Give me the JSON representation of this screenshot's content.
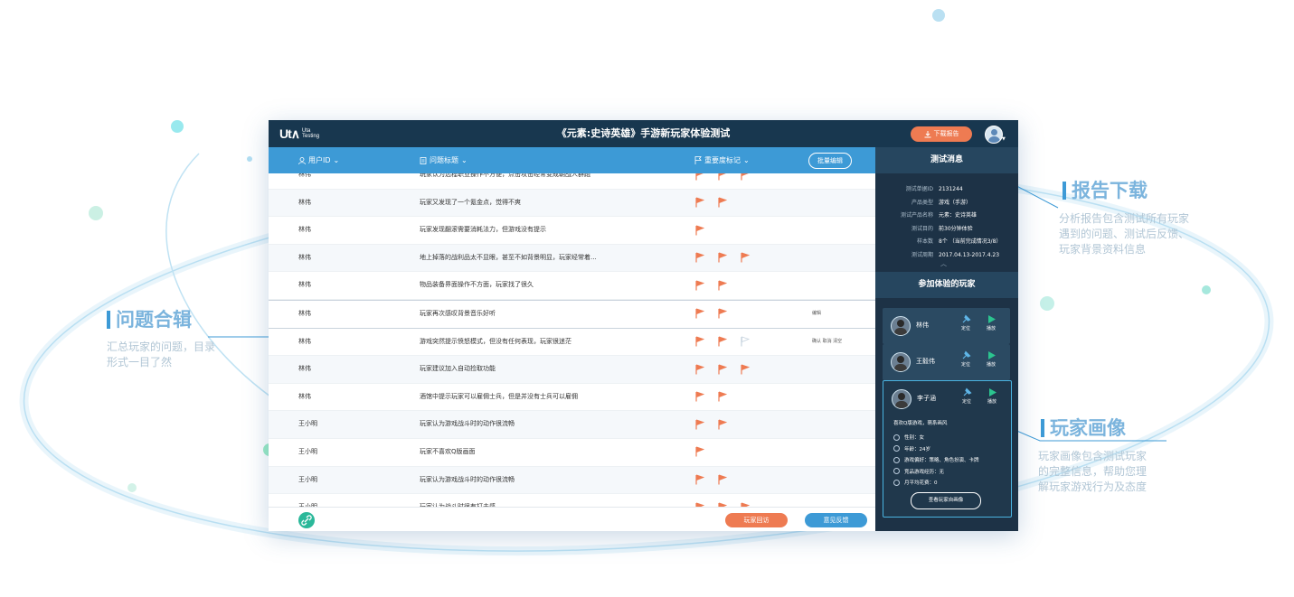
{
  "app": {
    "logo_mark": "Ut∧",
    "logo_sub_1": "Uta",
    "logo_sub_2": "Testing",
    "title": "《元素:史诗英雄》手游新玩家体验测试",
    "download_label": "下载报告"
  },
  "table": {
    "headers": {
      "user_id": "用户ID",
      "issue_title": "问题标题",
      "importance": "重要度标记"
    },
    "batch_edit": "批量编辑",
    "rows": [
      {
        "user": "林伟",
        "title": "玩家认为远程职业操作不方便，点击攻击经常变成朝战人群跑",
        "flags": [
          1,
          1,
          1
        ],
        "tools": ""
      },
      {
        "user": "林伟",
        "title": "玩家又发现了一个氪金点，觉得不爽",
        "flags": [
          1,
          1
        ],
        "tools": ""
      },
      {
        "user": "林伟",
        "title": "玩家发现翻滚需要消耗法力，但游戏没有提示",
        "flags": [
          1
        ],
        "tools": ""
      },
      {
        "user": "林伟",
        "title": "地上掉落的战利品太不显眼，甚至不如背景明显，玩家经常着...",
        "flags": [
          1,
          1,
          1
        ],
        "tools": ""
      },
      {
        "user": "林伟",
        "title": "物品装备界面操作不方面，玩家找了很久",
        "flags": [
          1,
          1
        ],
        "tools": ""
      },
      {
        "user": "林伟",
        "title": "玩家再次感叹背景音乐好听",
        "flags": [
          1,
          1
        ],
        "tools": "编辑",
        "active": true
      },
      {
        "user": "林伟",
        "title": "游戏突然提示愤怒模式，但没有任何表现，玩家很迷茫",
        "flags": [
          1,
          1,
          0
        ],
        "tools": "确认  取消  清空"
      },
      {
        "user": "林伟",
        "title": "玩家建议加入自动捡取功能",
        "flags": [
          1,
          1,
          1
        ],
        "tools": ""
      },
      {
        "user": "林伟",
        "title": "酒馆中提示玩家可以雇佣士兵，但是并没有士兵可以雇佣",
        "flags": [
          1,
          1
        ],
        "tools": ""
      },
      {
        "user": "王小明",
        "title": "玩家认为游戏战斗时的动作很流畅",
        "flags": [
          1,
          1
        ],
        "tools": ""
      },
      {
        "user": "王小明",
        "title": "玩家不喜欢Q版画面",
        "flags": [
          1
        ],
        "tools": ""
      },
      {
        "user": "王小明",
        "title": "玩家认为游戏战斗时的动作很流畅",
        "flags": [
          1,
          1
        ],
        "tools": ""
      },
      {
        "user": "王小明",
        "title": "玩家认为战斗时很有打击感",
        "flags": [
          1,
          1,
          1
        ],
        "tools": ""
      }
    ]
  },
  "bottom": {
    "review_label": "玩家回访",
    "feedback_label": "意见反馈"
  },
  "sidebar": {
    "test_info_title": "测试消息",
    "info": [
      {
        "label": "测试单据ID",
        "value": "2131244"
      },
      {
        "label": "产品类型",
        "value": "游戏（手游）"
      },
      {
        "label": "测试产品名称",
        "value": "元素：史诗英雄"
      },
      {
        "label": "测试目的",
        "value": "前30分钟体验"
      },
      {
        "label": "样本数",
        "value": "8个 （当前完成情况3/8）"
      },
      {
        "label": "测试周期",
        "value": "2017.04.13-2017.4.23"
      }
    ],
    "players_title": "参加体验的玩家",
    "locate_label": "定位",
    "play_label": "播放",
    "players": [
      {
        "name": "林伟"
      },
      {
        "name": "王毅伟"
      },
      {
        "name": "李子涵"
      }
    ],
    "profile": {
      "tagline": "喜欢Q版游戏，萌系画风",
      "details": [
        "性别：女",
        "年龄：24岁",
        "游戏偏好：策略、角色扮演、卡牌",
        "竞品游戏经历：无",
        "月平均花费：0"
      ],
      "button": "查看玩家自画像"
    }
  },
  "annotations": {
    "report": {
      "title": "报告下载",
      "desc": [
        "分析报告包含测试所有玩家",
        "遇到的问题、测试后反馈、",
        "玩家背景资料信息"
      ]
    },
    "issues": {
      "title": "问题合辑",
      "desc": [
        "汇总玩家的问题，目录",
        "形式一目了然"
      ]
    },
    "profile": {
      "title": "玩家画像",
      "desc": [
        "玩家画像包含测试玩家",
        "的完整信息，帮助您理",
        "解玩家游戏行为及态度"
      ]
    }
  },
  "colors": {
    "topbar": "#18374f",
    "header_blue": "#3d9ad6",
    "flag_orange": "#ee7b52",
    "sidebar": "#1d3246",
    "accent_teal": "#2bb89a"
  }
}
